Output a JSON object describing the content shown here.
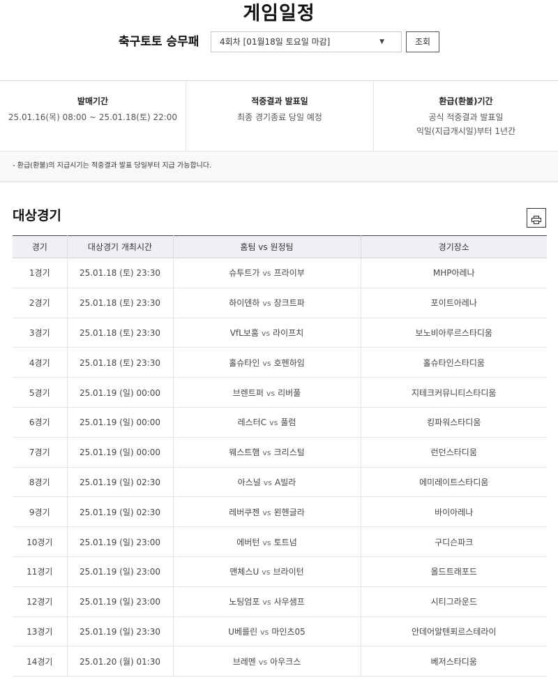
{
  "page_title": "게임일정",
  "game_name": "축구토토 승무패",
  "round_select": {
    "value": "4회차 [01월18일 토요일 마감]",
    "caret": "▼"
  },
  "query_button": "조회",
  "info": {
    "boxes": [
      {
        "title": "발매기간",
        "lines": [
          "25.01.16(목) 08:00 ~ 25.01.18(토) 22:00"
        ]
      },
      {
        "title": "적중결과 발표일",
        "lines": [
          "최종 경기종료 당일 예정"
        ]
      },
      {
        "title": "환급(환불)기간",
        "lines": [
          "공식 적중결과 발표일",
          "익일(지급개시일)부터 1년간"
        ]
      }
    ],
    "note": "- 환급(환불)의 지급시기는 적중결과 발표 당일부터 지급 가능합니다."
  },
  "section_title": "대상경기",
  "table": {
    "headers": [
      "경기",
      "대상경기 개최시간",
      "홈팀 vs 원정팀",
      "경기장소"
    ],
    "vs_label": "vs",
    "rows": [
      {
        "no": "1경기",
        "time": "25.01.18 (토) 23:30",
        "home": "슈투트가",
        "away": "프라이부",
        "venue": "MHP아레나"
      },
      {
        "no": "2경기",
        "time": "25.01.18 (토) 23:30",
        "home": "하이덴하",
        "away": "장크트파",
        "venue": "포이트아레나"
      },
      {
        "no": "3경기",
        "time": "25.01.18 (토) 23:30",
        "home": "VfL보훔",
        "away": "라이프치",
        "venue": "보노비아루르스타디움"
      },
      {
        "no": "4경기",
        "time": "25.01.18 (토) 23:30",
        "home": "홀슈타인",
        "away": "호펜하임",
        "venue": "홀슈타인스타디움"
      },
      {
        "no": "5경기",
        "time": "25.01.19 (일) 00:00",
        "home": "브렌트퍼",
        "away": "리버풀",
        "venue": "지테크커뮤니티스타디움"
      },
      {
        "no": "6경기",
        "time": "25.01.19 (일) 00:00",
        "home": "레스터C",
        "away": "풀럼",
        "venue": "킹파워스타디움"
      },
      {
        "no": "7경기",
        "time": "25.01.19 (일) 00:00",
        "home": "웨스트햄",
        "away": "크리스털",
        "venue": "런던스타디움"
      },
      {
        "no": "8경기",
        "time": "25.01.19 (일) 02:30",
        "home": "아스널",
        "away": "A빌라",
        "venue": "에미레이트스타디움"
      },
      {
        "no": "9경기",
        "time": "25.01.19 (일) 02:30",
        "home": "레버쿠젠",
        "away": "묀헨글라",
        "venue": "바이아레나"
      },
      {
        "no": "10경기",
        "time": "25.01.19 (일) 23:00",
        "home": "에버턴",
        "away": "토트넘",
        "venue": "구디슨파크"
      },
      {
        "no": "11경기",
        "time": "25.01.19 (일) 23:00",
        "home": "맨체스U",
        "away": "브라이턴",
        "venue": "올드트래포드"
      },
      {
        "no": "12경기",
        "time": "25.01.19 (일) 23:00",
        "home": "노팅엄포",
        "away": "사우샘프",
        "venue": "시티그라운드"
      },
      {
        "no": "13경기",
        "time": "25.01.19 (일) 23:30",
        "home": "U베를린",
        "away": "마인츠05",
        "venue": "안데어알텐푀르스테라이"
      },
      {
        "no": "14경기",
        "time": "25.01.20 (월) 01:30",
        "home": "브레멘",
        "away": "아우크스",
        "venue": "베저스타디움"
      }
    ]
  }
}
